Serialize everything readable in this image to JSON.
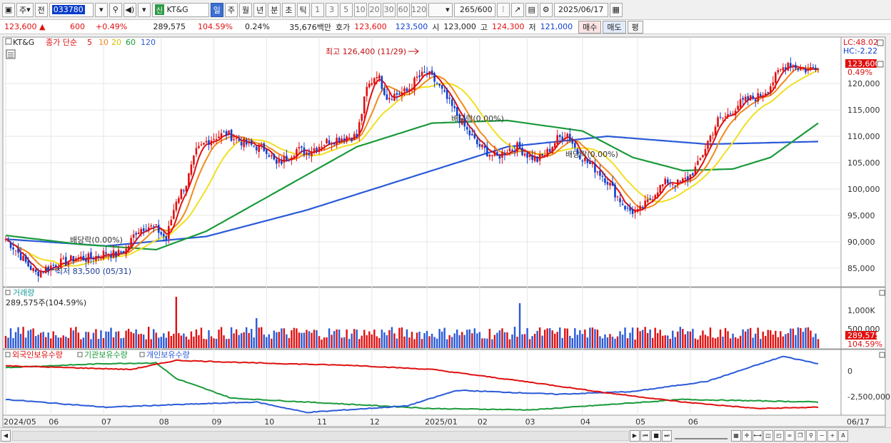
{
  "toolbar": {
    "market": "주",
    "prev": "전",
    "code": "033780",
    "badge": "신",
    "name": "KT&G",
    "periods": [
      "일",
      "주",
      "월",
      "년",
      "분",
      "초",
      "틱"
    ],
    "active_period": "일",
    "numbers": [
      "1",
      "3",
      "5",
      "10",
      "20",
      "30",
      "60",
      "120"
    ],
    "count": "265",
    "count_total": "/600",
    "date": "2025/06/17"
  },
  "quote": {
    "price": "123,600 ▲",
    "change": "600",
    "change_pct": "+0.49%",
    "volume": "289,575",
    "vol_ratio": "104.59%",
    "turnover": "0.24%",
    "amount": "35,676백만",
    "hoga_label": "호가",
    "ask": "123,600",
    "bid": "123,500",
    "open_label": "시",
    "open": "123,000",
    "high_label": "고",
    "high": "124,300",
    "low_label": "저",
    "low": "121,000",
    "buy": "매수",
    "sell": "매도",
    "eval": "평"
  },
  "price_panel": {
    "stock_label": "KT&G",
    "ma_label": "종가 단순",
    "ma_periods": [
      "5",
      "10",
      "20",
      "60",
      "120"
    ],
    "ma_colors": [
      "#e01010",
      "#f08a1c",
      "#f0e020",
      "#1a9a3a",
      "#2a5ad8"
    ],
    "lc": "LC:48.02",
    "hc": "HC:-2.22",
    "current_price": "123,600",
    "current_pct": "0.49%",
    "high_annot": "최고 126,400 (11/29)",
    "low_annot": "최저 83,500 (05/31)",
    "div_annot_1": "배당락(0.00%)",
    "div_annot_2": "배당락(0.00%)",
    "div_annot_3": "배당락(0.00%)",
    "y_ticks": [
      "120,000",
      "115,000",
      "110,000",
      "105,000",
      "100,000",
      "95,000",
      "90,000",
      "85,000"
    ]
  },
  "volume_panel": {
    "title": "거래량",
    "value_label": "289,575주(104.59%)",
    "y_ticks": [
      "1,000K",
      "500,000"
    ],
    "current_value": "289,575",
    "current_pct": "104.59%"
  },
  "holding_panel": {
    "legend": [
      "외국인보유수량",
      "기관보유수량",
      "개인보유수량"
    ],
    "legend_colors": [
      "#e01010",
      "#1a9a3a",
      "#2a5ad8"
    ],
    "y_ticks": [
      "0",
      "-2,500,000"
    ]
  },
  "x_axis": {
    "labels": [
      "2024/05",
      "06",
      "07",
      "08",
      "09",
      "10",
      "11",
      "12",
      "2025/01",
      "02",
      "03",
      "04",
      "05",
      "06"
    ],
    "right_label": "06/17"
  },
  "chart_data": {
    "type": "candlestick",
    "symbol": "KT&G",
    "x_labels": [
      "2024/05",
      "06",
      "07",
      "08",
      "09",
      "10",
      "11",
      "12",
      "2025/01",
      "02",
      "03",
      "04",
      "05",
      "06"
    ],
    "ylim": [
      82000,
      128000
    ],
    "close_series": [
      [
        0,
        90500
      ],
      [
        4,
        88500
      ],
      [
        8,
        86000
      ],
      [
        12,
        84000
      ],
      [
        16,
        85000
      ],
      [
        20,
        85800
      ],
      [
        24,
        86200
      ],
      [
        28,
        87000
      ],
      [
        32,
        86800
      ],
      [
        36,
        87200
      ],
      [
        40,
        88000
      ],
      [
        44,
        87500
      ],
      [
        48,
        88500
      ],
      [
        52,
        92000
      ],
      [
        56,
        93000
      ],
      [
        60,
        92500
      ],
      [
        64,
        90500
      ],
      [
        68,
        98000
      ],
      [
        72,
        101000
      ],
      [
        76,
        107000
      ],
      [
        80,
        109000
      ],
      [
        84,
        110000
      ],
      [
        88,
        110500
      ],
      [
        92,
        109500
      ],
      [
        96,
        108500
      ],
      [
        100,
        108000
      ],
      [
        104,
        107500
      ],
      [
        108,
        104500
      ],
      [
        112,
        106000
      ],
      [
        116,
        107500
      ],
      [
        120,
        107000
      ],
      [
        124,
        108000
      ],
      [
        128,
        109000
      ],
      [
        132,
        109500
      ],
      [
        136,
        110000
      ],
      [
        140,
        110000
      ],
      [
        144,
        119000
      ],
      [
        148,
        122000
      ],
      [
        152,
        117500
      ],
      [
        156,
        118000
      ],
      [
        160,
        118500
      ],
      [
        164,
        121000
      ],
      [
        168,
        122000
      ],
      [
        172,
        120000
      ],
      [
        176,
        117000
      ],
      [
        180,
        114000
      ],
      [
        184,
        111000
      ],
      [
        188,
        108500
      ],
      [
        192,
        107000
      ],
      [
        196,
        106000
      ],
      [
        200,
        107500
      ],
      [
        204,
        108000
      ],
      [
        208,
        106500
      ],
      [
        212,
        105500
      ],
      [
        216,
        107000
      ],
      [
        220,
        109500
      ],
      [
        224,
        110500
      ],
      [
        228,
        107000
      ],
      [
        232,
        105000
      ],
      [
        236,
        103500
      ],
      [
        240,
        101500
      ],
      [
        244,
        98500
      ],
      [
        248,
        96000
      ],
      [
        252,
        95500
      ],
      [
        256,
        97500
      ],
      [
        260,
        100000
      ],
      [
        264,
        101500
      ],
      [
        268,
        101000
      ],
      [
        272,
        102000
      ],
      [
        276,
        104500
      ],
      [
        280,
        109000
      ],
      [
        284,
        113000
      ],
      [
        288,
        114000
      ],
      [
        292,
        116000
      ],
      [
        296,
        117000
      ],
      [
        300,
        117500
      ],
      [
        304,
        119000
      ],
      [
        308,
        122000
      ],
      [
        312,
        124000
      ],
      [
        316,
        123000
      ],
      [
        320,
        122500
      ],
      [
        324,
        123600
      ]
    ],
    "ma120_series": [
      [
        0,
        90500
      ],
      [
        40,
        89200
      ],
      [
        80,
        91000
      ],
      [
        120,
        96000
      ],
      [
        160,
        102000
      ],
      [
        200,
        108000
      ],
      [
        240,
        110000
      ],
      [
        280,
        108500
      ],
      [
        324,
        109000
      ]
    ],
    "ma60_series": [
      [
        0,
        91200
      ],
      [
        30,
        89500
      ],
      [
        60,
        88500
      ],
      [
        80,
        92000
      ],
      [
        110,
        100000
      ],
      [
        140,
        108000
      ],
      [
        170,
        112500
      ],
      [
        200,
        113000
      ],
      [
        230,
        111000
      ],
      [
        250,
        106000
      ],
      [
        270,
        103500
      ],
      [
        290,
        103800
      ],
      [
        305,
        106000
      ],
      [
        324,
        112500
      ]
    ],
    "volume": {
      "ylim": [
        0,
        1300000
      ],
      "spikes": [
        [
          68,
          1200000
        ],
        [
          205,
          1050000
        ],
        [
          100,
          700000
        ]
      ]
    },
    "holdings": {
      "foreign": [
        [
          0,
          480000
        ],
        [
          50,
          200000
        ],
        [
          68,
          900000
        ],
        [
          100,
          700000
        ],
        [
          140,
          500000
        ],
        [
          170,
          200000
        ],
        [
          210,
          -800000
        ],
        [
          240,
          -1600000
        ],
        [
          270,
          -2300000
        ],
        [
          300,
          -2800000
        ],
        [
          324,
          -2700000
        ]
      ],
      "institution": [
        [
          0,
          350000
        ],
        [
          40,
          650000
        ],
        [
          60,
          700000
        ],
        [
          68,
          -500000
        ],
        [
          90,
          -2000000
        ],
        [
          130,
          -2400000
        ],
        [
          170,
          -2800000
        ],
        [
          210,
          -2900000
        ],
        [
          240,
          -2500000
        ],
        [
          270,
          -2100000
        ],
        [
          324,
          -2300000
        ]
      ],
      "individual": [
        [
          0,
          -2100000
        ],
        [
          40,
          -2700000
        ],
        [
          68,
          -2500000
        ],
        [
          100,
          -2300000
        ],
        [
          120,
          -3100000
        ],
        [
          160,
          -2600000
        ],
        [
          180,
          -1400000
        ],
        [
          220,
          -1700000
        ],
        [
          250,
          -1500000
        ],
        [
          280,
          -700000
        ],
        [
          310,
          1200000
        ],
        [
          324,
          650000
        ]
      ]
    }
  }
}
